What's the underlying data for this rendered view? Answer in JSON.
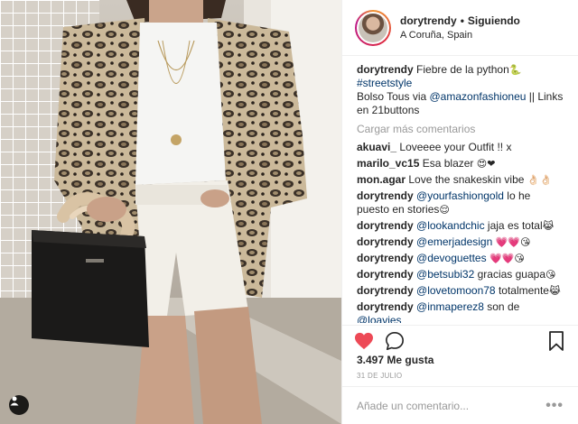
{
  "post": {
    "username": "dorytrendy",
    "separator": "•",
    "follow_label": "Siguiendo",
    "location": "A Coruña, Spain"
  },
  "caption": {
    "username": "dorytrendy",
    "line1": "Fiebre de la python",
    "emoji1": "🐍",
    "hashtag": "#streetstyle",
    "line3_before": "Bolso Tous via ",
    "mention": "@amazonfashioneu",
    "line3_after": " || Links en 21buttons"
  },
  "load_more_label": "Cargar más comentarios",
  "comments": [
    {
      "user": "akuavi_",
      "text": "Loveeee your Outfit !! x"
    },
    {
      "user": "marilo_vc15",
      "text": "Esa blazer",
      "emoji": "😍❤"
    },
    {
      "user": "mon.agar",
      "text": "Love the snakeskin vibe",
      "emoji": "👌🏻👌🏻"
    },
    {
      "user": "dorytrendy",
      "mention": "@yourfashiongold",
      "text": " lo he puesto en stories",
      "emoji": "😌"
    },
    {
      "user": "dorytrendy",
      "mention": "@lookandchic",
      "text": " jaja es total",
      "emoji": "😹"
    },
    {
      "user": "dorytrendy",
      "mention": "@emerjadesign",
      "text": " ",
      "emoji": "💗💗😘"
    },
    {
      "user": "dorytrendy",
      "mention": "@devoguettes",
      "text": " ",
      "emoji": "💗💗😘"
    },
    {
      "user": "dorytrendy",
      "mention": "@betsubi32",
      "text": " gracias guapa",
      "emoji": "😘"
    },
    {
      "user": "dorytrendy",
      "mention": "@lovetomoon78",
      "text": " totalmente",
      "emoji": "😹"
    },
    {
      "user": "dorytrendy",
      "mention": "@inmaperez8",
      "text": " son de ",
      "mention2": "@loavies",
      "emoji": "😘"
    }
  ],
  "likes": "3.497 Me gusta",
  "date": "31 DE JULIO",
  "add_comment_placeholder": "Añade un comentario...",
  "more_dots": "•••",
  "photo": {
    "brand_text": "TOUS"
  },
  "icons": {
    "like": "heart-icon",
    "comment": "comment-icon",
    "save": "bookmark-icon",
    "tag": "user-tag-icon",
    "more": "more-options-icon"
  },
  "colors": {
    "like_red": "#ed4956",
    "link_blue": "#003569",
    "muted": "#999999",
    "text": "#262626"
  }
}
